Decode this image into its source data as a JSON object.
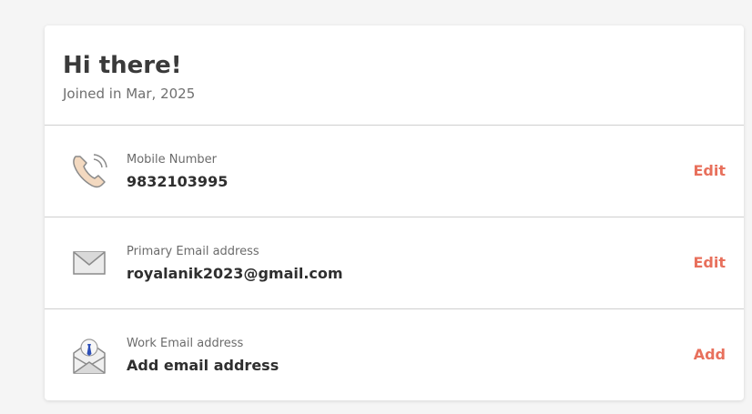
{
  "profile": {
    "greeting": "Hi there!",
    "joined": "Joined in Mar, 2025"
  },
  "rows": [
    {
      "icon": "phone-icon",
      "label": "Mobile Number",
      "value": "9832103995",
      "action": "Edit"
    },
    {
      "icon": "envelope-icon",
      "label": "Primary Email address",
      "value": "royalanik2023@gmail.com",
      "action": "Edit"
    },
    {
      "icon": "work-email-icon",
      "label": "Work Email address",
      "value": "Add email address",
      "action": "Add"
    }
  ],
  "colors": {
    "accent": "#e8705c",
    "background": "#f5f5f5",
    "card": "#ffffff"
  }
}
